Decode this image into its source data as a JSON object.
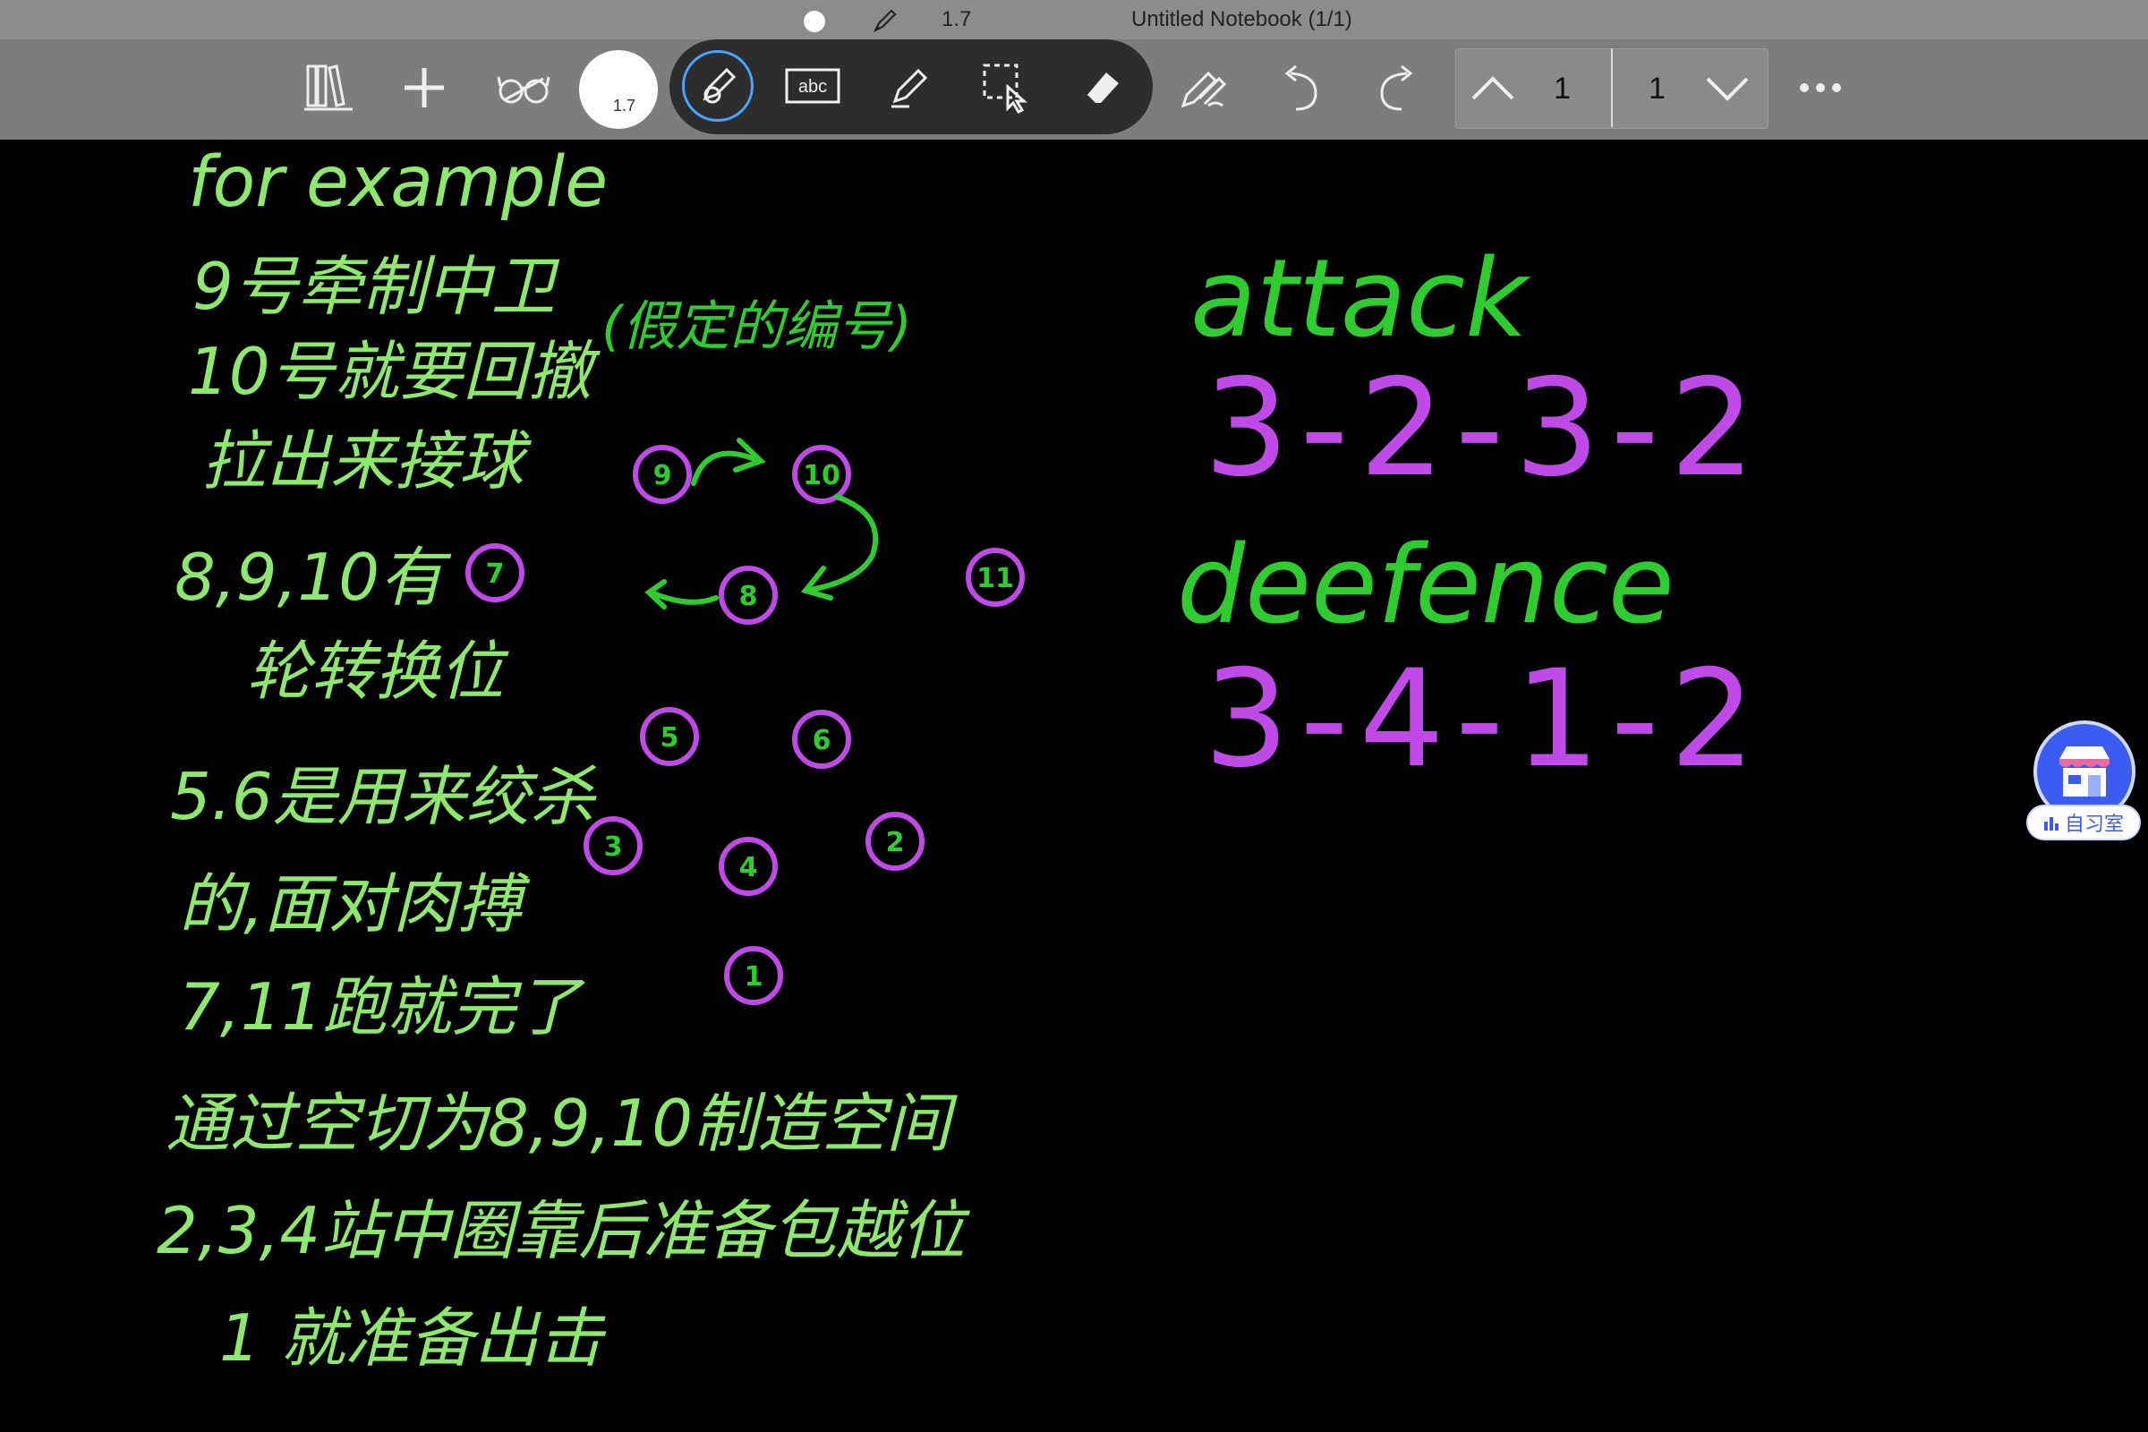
{
  "titlebar": {
    "pen_size": "1.7",
    "title": "Untitled Notebook (1/1)"
  },
  "toolbar": {
    "color_swatch_label": "1.7",
    "current_page": "1",
    "total_pages": "1",
    "tools": [
      "library-icon",
      "add-icon",
      "reading-glasses-icon",
      "color-swatch",
      "pen-tool-icon",
      "text-tool-icon",
      "highlighter-icon",
      "lasso-select-icon",
      "eraser-icon",
      "pen-settings-icon",
      "undo-icon",
      "redo-icon",
      "page-up-icon",
      "page-down-icon",
      "more-icon"
    ]
  },
  "colors": {
    "toolbar_bg": "#7d7d7d",
    "titlebar_bg": "#8c8c8c",
    "pill_bg": "#2d2d2d",
    "ink_green_light": "#8ee86e",
    "ink_green": "#2ecc2e",
    "ink_purple": "#c04ae8",
    "widget_blue": "#3a5cf0"
  },
  "notes": {
    "left_lines": [
      "for example",
      "9号牵制中卫",
      "10号就要回撤",
      "拉出来接球",
      "8,9,10有",
      "轮转换位",
      "5.6是用来绞杀",
      "的,面对肉搏",
      "7,11跑就完了",
      "通过空切为8,9,10制造空间",
      "2,3,4站中圈靠后准备包越位",
      "1 就准备出击"
    ],
    "diagram_caption": "(假定的编号)",
    "attack_label": "attack",
    "attack_formation": "3-2-3-2",
    "defence_label": "deefence",
    "defence_formation": "3-4-1-2"
  },
  "players": [
    "9",
    "10",
    "7",
    "8",
    "11",
    "5",
    "6",
    "3",
    "4",
    "2",
    "1"
  ],
  "study_widget": {
    "label": "自习室"
  }
}
